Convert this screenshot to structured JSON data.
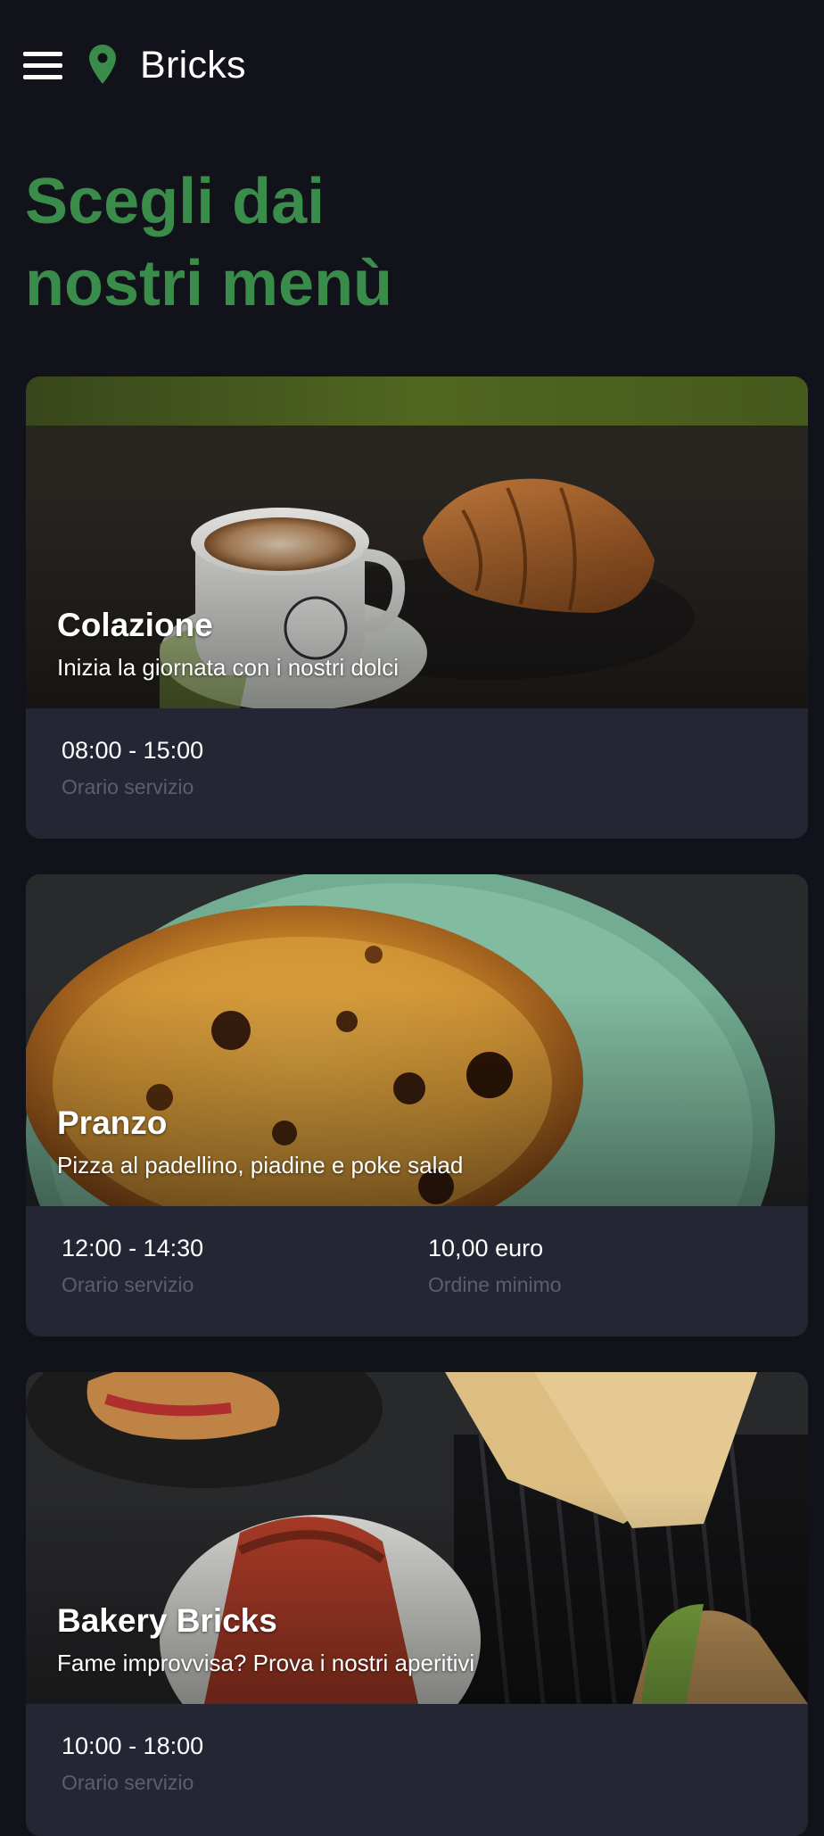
{
  "header": {
    "menu_icon": "hamburger-icon",
    "location_icon": "map-pin-icon",
    "title": "Bricks"
  },
  "headline": {
    "line1": "Scegli dai",
    "line2": "nostri menù"
  },
  "menus": [
    {
      "title": "Colazione",
      "subtitle": "Inizia la giornata con i nostri dolci",
      "hours": "08:00 - 15:00",
      "hours_label": "Orario servizio"
    },
    {
      "title": "Pranzo",
      "subtitle": "Pizza al padellino, piadine e poke salad",
      "hours": "12:00 - 14:30",
      "hours_label": "Orario servizio",
      "minimum": "10,00 euro",
      "minimum_label": "Ordine minimo"
    },
    {
      "title": "Bakery Bricks",
      "subtitle": "Fame improvvisa? Prova i nostri aperitivi",
      "hours": "10:00 - 18:00",
      "hours_label": "Orario servizio"
    }
  ],
  "colors": {
    "background": "#12131a",
    "accent": "#3a8c4a",
    "card": "#252634",
    "muted_text": "#5c5e6e"
  }
}
